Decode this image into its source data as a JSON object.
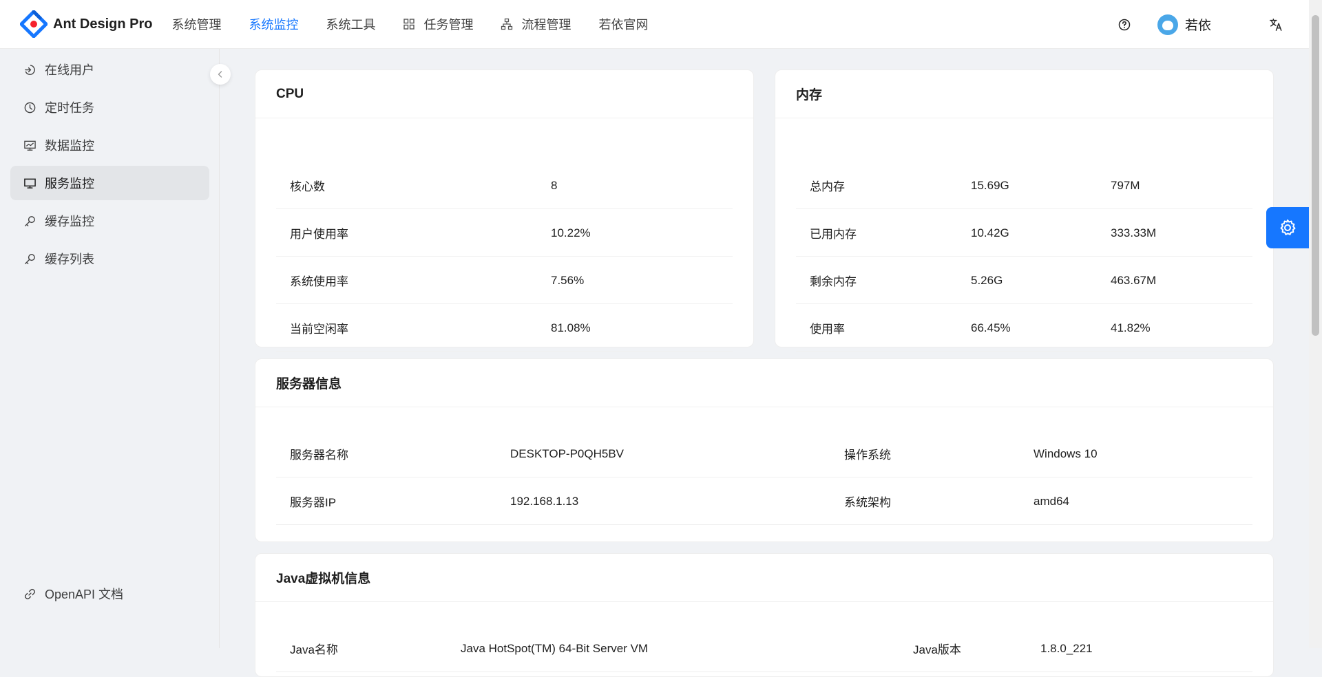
{
  "app": {
    "title": "Ant Design Pro"
  },
  "topnav": [
    {
      "label": "系统管理",
      "active": false,
      "icon": ""
    },
    {
      "label": "系统监控",
      "active": true,
      "icon": ""
    },
    {
      "label": "系统工具",
      "active": false,
      "icon": ""
    },
    {
      "label": "任务管理",
      "active": false,
      "icon": "appstore-icon"
    },
    {
      "label": "流程管理",
      "active": false,
      "icon": "cluster-icon"
    },
    {
      "label": "若依官网",
      "active": false,
      "icon": ""
    }
  ],
  "user": {
    "name": "若依"
  },
  "sidebar": {
    "items": [
      {
        "label": "在线用户",
        "icon": "login-icon",
        "active": false
      },
      {
        "label": "定时任务",
        "icon": "clock-icon",
        "active": false
      },
      {
        "label": "数据监控",
        "icon": "fund-projection-icon",
        "active": false
      },
      {
        "label": "服务监控",
        "icon": "desktop-icon",
        "active": true
      },
      {
        "label": "缓存监控",
        "icon": "key-icon",
        "active": false
      },
      {
        "label": "缓存列表",
        "icon": "key-icon",
        "active": false
      }
    ],
    "footer": {
      "label": "OpenAPI 文档",
      "icon": "link-icon"
    }
  },
  "colors": {
    "accent": "#1677ff",
    "background": "#f0f2f5"
  },
  "cpu": {
    "title": "CPU",
    "rows": [
      {
        "label": "核心数",
        "value": "8"
      },
      {
        "label": "用户使用率",
        "value": "10.22%"
      },
      {
        "label": "系统使用率",
        "value": "7.56%"
      },
      {
        "label": "当前空闲率",
        "value": "81.08%"
      }
    ]
  },
  "memory": {
    "title": "内存",
    "rows": [
      {
        "label": "总内存",
        "v1": "15.69G",
        "v2": "797M"
      },
      {
        "label": "已用内存",
        "v1": "10.42G",
        "v2": "333.33M"
      },
      {
        "label": "剩余内存",
        "v1": "5.26G",
        "v2": "463.67M"
      },
      {
        "label": "使用率",
        "v1": "66.45%",
        "v2": "41.82%"
      }
    ]
  },
  "server": {
    "title": "服务器信息",
    "rows": [
      {
        "k1": "服务器名称",
        "v1": "DESKTOP-P0QH5BV",
        "k2": "操作系统",
        "v2": "Windows 10"
      },
      {
        "k1": "服务器IP",
        "v1": "192.168.1.13",
        "k2": "系统架构",
        "v2": "amd64"
      }
    ]
  },
  "jvm": {
    "title": "Java虚拟机信息",
    "rows": [
      {
        "k1": "Java名称",
        "v1": "Java HotSpot(TM) 64-Bit Server VM",
        "k2": "Java版本",
        "v2": "1.8.0_221"
      }
    ]
  }
}
